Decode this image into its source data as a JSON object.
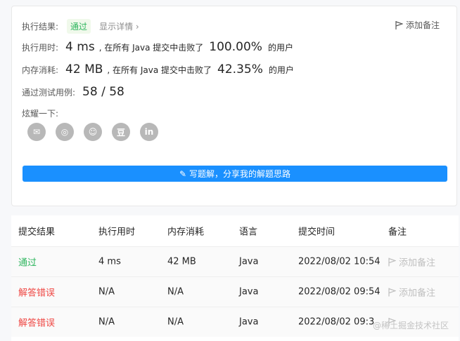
{
  "result": {
    "label": "执行结果:",
    "status": "通过",
    "details_link": "显示详情 ›",
    "add_note": "添加备注"
  },
  "runtime": {
    "label": "执行用时:",
    "value": "4 ms",
    "middle": ", 在所有 Java 提交中击败了",
    "percent": "100.00%",
    "suffix": "的用户"
  },
  "memory": {
    "label": "内存消耗:",
    "value": "42 MB",
    "middle": ", 在所有 Java 提交中击败了",
    "percent": "42.35%",
    "suffix": "的用户"
  },
  "testcases": {
    "label": "通过测试用例:",
    "value": "58 / 58"
  },
  "share": {
    "label": "炫耀一下:",
    "icons": [
      {
        "name": "wechat-icon",
        "glyph": "✉"
      },
      {
        "name": "weibo-icon",
        "glyph": "◎"
      },
      {
        "name": "qq-icon",
        "glyph": "☺"
      },
      {
        "name": "douban-icon",
        "glyph": "豆"
      },
      {
        "name": "linkedin-icon",
        "glyph": "in"
      }
    ]
  },
  "write_solution_button": "写题解，分享我的解题思路",
  "table": {
    "headers": [
      "提交结果",
      "执行用时",
      "内存消耗",
      "语言",
      "提交时间",
      "备注"
    ],
    "rows": [
      {
        "result": "通过",
        "time": "4 ms",
        "memory": "42 MB",
        "lang": "Java",
        "submitted": "2022/08/02 10:54",
        "note": "添加备注"
      },
      {
        "result": "解答错误",
        "time": "N/A",
        "memory": "N/A",
        "lang": "Java",
        "submitted": "2022/08/02 09:54",
        "note": "添加备注"
      },
      {
        "result": "解答错误",
        "time": "N/A",
        "memory": "N/A",
        "lang": "Java",
        "submitted": "2022/08/02 09:3",
        "note": ""
      }
    ]
  },
  "watermark": "@稀土掘金技术社区",
  "colors": {
    "accent": "#1a90ff",
    "success": "#2db55d",
    "error": "#ef4743"
  }
}
